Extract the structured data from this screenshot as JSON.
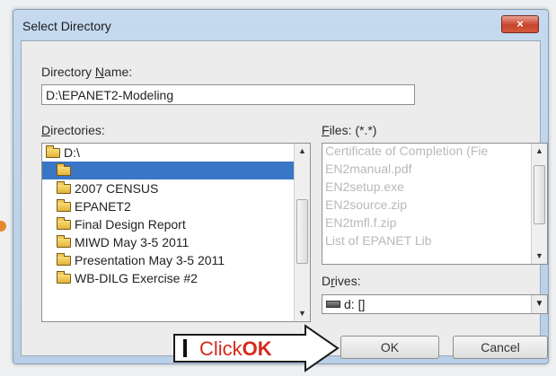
{
  "window": {
    "title": "Select Directory",
    "close_label": "×"
  },
  "directory_name": {
    "label_pre": "Directory ",
    "label_access": "N",
    "label_post": "ame:",
    "value": "D:\\EPANET2-Modeling"
  },
  "directories": {
    "label_access": "D",
    "label_post": "irectories:",
    "items": [
      {
        "label": "D:\\",
        "open": true
      },
      {
        "label": "",
        "open": true,
        "selected": true
      },
      {
        "label": "2007 CENSUS"
      },
      {
        "label": "EPANET2"
      },
      {
        "label": "Final Design Report"
      },
      {
        "label": "MIWD May 3-5 2011"
      },
      {
        "label": "Presentation May 3-5 2011"
      },
      {
        "label": "WB-DILG Exercise #2"
      }
    ]
  },
  "files": {
    "label_access": "F",
    "label_post": "iles: (*.*)",
    "items": [
      "Certificate of Completion (Fie",
      "EN2manual.pdf",
      "EN2setup.exe",
      "EN2source.zip",
      "EN2tmfl.f.zip",
      "List of EPANET Lib"
    ]
  },
  "drives": {
    "label_pre": "D",
    "label_access": "r",
    "label_post": "ives:",
    "value": "d: []"
  },
  "buttons": {
    "ok": "OK",
    "cancel": "Cancel"
  },
  "annotation": {
    "prefix": "Click",
    "emphasis": "OK"
  },
  "colors": {
    "selection": "#3a76c6",
    "callout_text": "#d52a1d",
    "close_button": "#c7442a"
  }
}
